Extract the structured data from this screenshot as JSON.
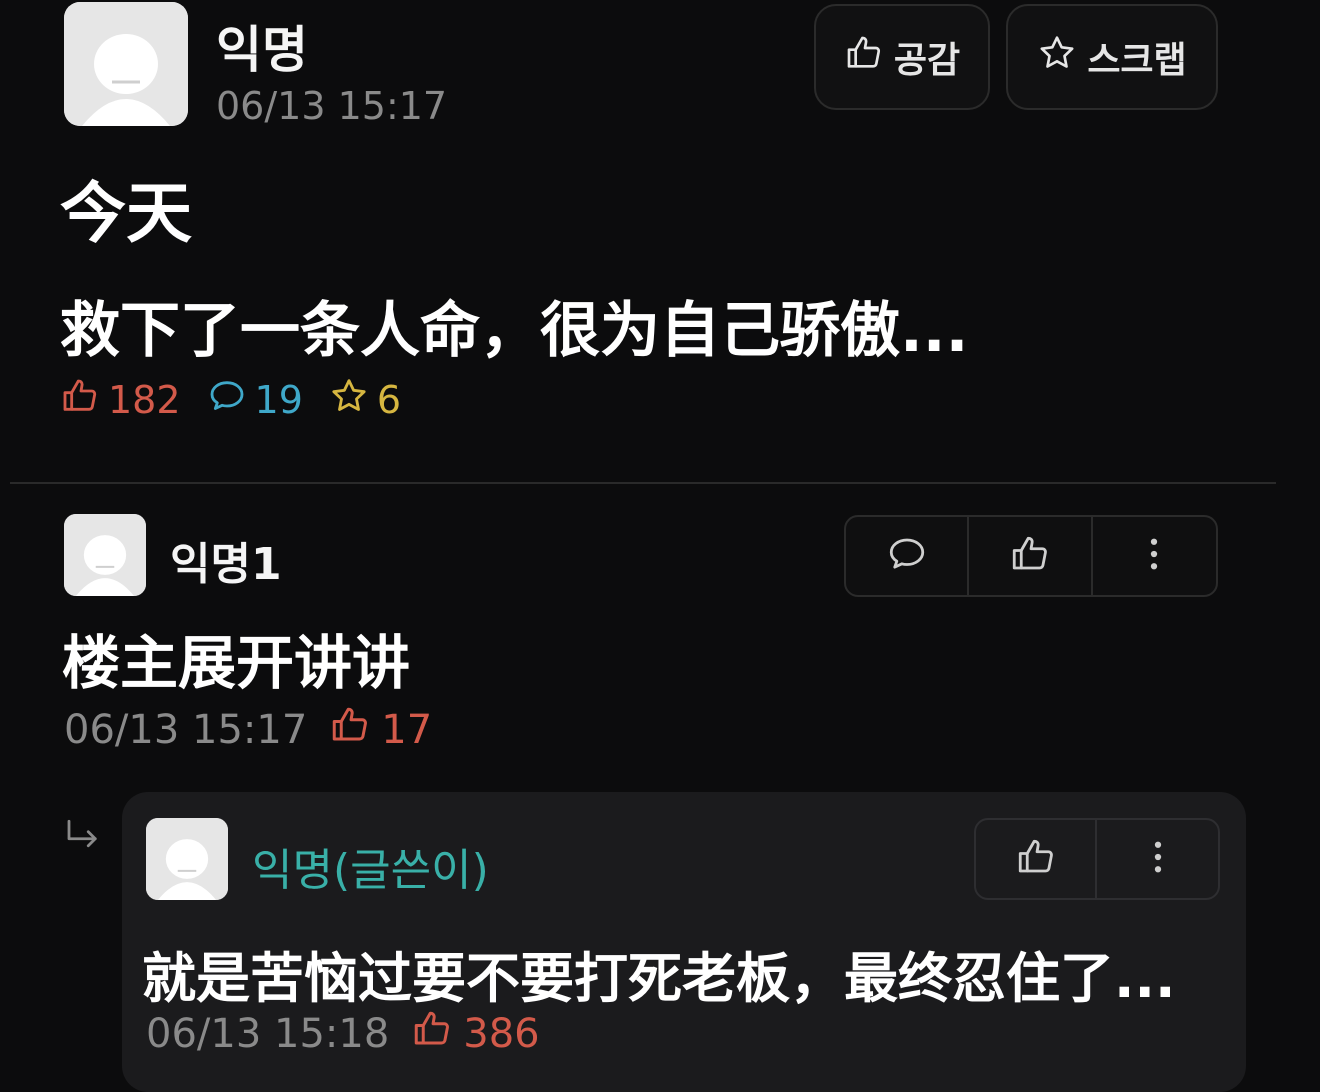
{
  "post": {
    "author": "익명",
    "date": "06/13 15:17",
    "buttons": {
      "like_label": "공감",
      "scrap_label": "스크랩"
    },
    "title": "今天",
    "body": "救下了一条人命，很为自己骄傲...",
    "stats": {
      "likes": "182",
      "comments": "19",
      "scraps": "6"
    }
  },
  "comment": {
    "author": "익명1",
    "text": "楼主展开讲讲",
    "date": "06/13 15:17",
    "likes": "17"
  },
  "reply": {
    "author": "익명(글쓴이)",
    "text": "就是苦恼过要不要打死老板，最终忍住了...",
    "date": "06/13 15:18",
    "likes": "386"
  },
  "colors": {
    "background": "#0c0c0d",
    "like": "#d35a4a",
    "comment": "#3fa8c9",
    "scrap": "#d6b640",
    "op_name": "#39b0a8"
  },
  "icons": [
    "avatar",
    "thumbs-up-icon",
    "star-icon",
    "comment-bubble-icon",
    "more-vertical-icon",
    "reply-arrow-icon"
  ]
}
